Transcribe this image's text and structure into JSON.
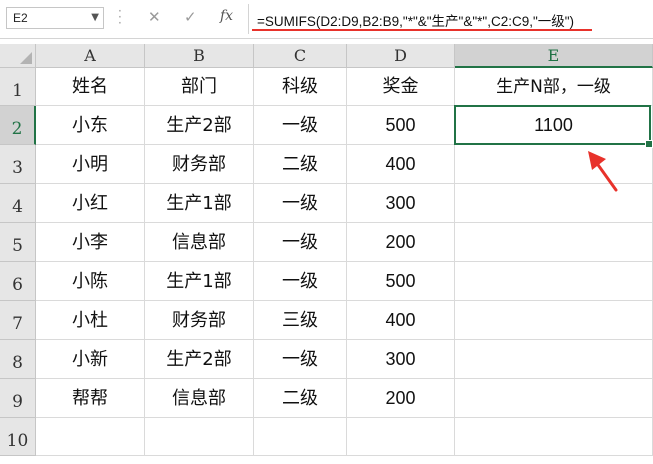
{
  "name_box": {
    "value": "E2"
  },
  "formula_bar": {
    "cancel_glyph": "✕",
    "enter_glyph": "✓",
    "fx_label": "fx",
    "formula": "=SUMIFS(D2:D9,B2:B9,\"*\"&\"生产\"&\"*\",C2:C9,\"一级\")"
  },
  "columns": [
    "A",
    "B",
    "C",
    "D",
    "E"
  ],
  "rows": [
    "1",
    "2",
    "3",
    "4",
    "5",
    "6",
    "7",
    "8",
    "9",
    "10"
  ],
  "table": {
    "header": [
      "姓名",
      "部门",
      "科级",
      "奖金",
      "生产N部，一级"
    ],
    "body": [
      [
        "小东",
        "生产2部",
        "一级",
        "500",
        "1100"
      ],
      [
        "小明",
        "财务部",
        "二级",
        "400",
        ""
      ],
      [
        "小红",
        "生产1部",
        "一级",
        "300",
        ""
      ],
      [
        "小李",
        "信息部",
        "一级",
        "200",
        ""
      ],
      [
        "小陈",
        "生产1部",
        "一级",
        "500",
        ""
      ],
      [
        "小杜",
        "财务部",
        "三级",
        "400",
        ""
      ],
      [
        "小新",
        "生产2部",
        "一级",
        "300",
        ""
      ],
      [
        "帮帮",
        "信息部",
        "二级",
        "200",
        ""
      ]
    ]
  },
  "selection": {
    "cell": "E2",
    "accent": "#217346"
  },
  "annotation": {
    "arrow_color": "#e8322b",
    "underline_color": "#e8322b"
  }
}
